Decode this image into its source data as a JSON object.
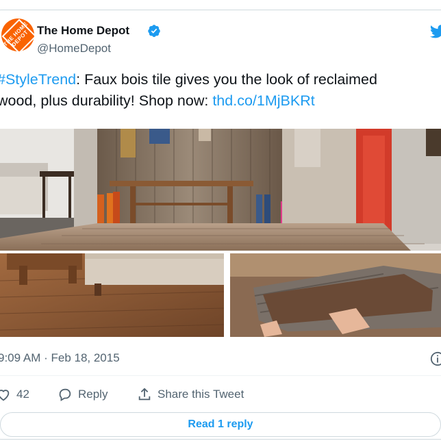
{
  "author": {
    "name": "The Home Depot",
    "handle": "@HomeDepot",
    "avatar_logo_text": "THE HOME DEPOT",
    "brand_color": "#f96302",
    "verified_color": "#1d9bf0"
  },
  "tweet": {
    "hashtag": "#StyleTrend",
    "text_part1": ": Faux bois tile gives you the look of reclaimed",
    "text_line2": "wood, plus durability! Shop now: ",
    "link": "thd.co/1MjBKRt",
    "link_color": "#1d9bf0"
  },
  "timestamp": "9:09 AM · Feb 18, 2015",
  "actions": {
    "like_count": "42",
    "reply_label": "Reply",
    "share_label": "Share this Tweet"
  },
  "read_replies_label": "Read 1 reply",
  "icons": [
    "verified-badge-icon",
    "twitter-bird-icon",
    "info-icon",
    "heart-icon",
    "reply-icon",
    "share-icon"
  ]
}
